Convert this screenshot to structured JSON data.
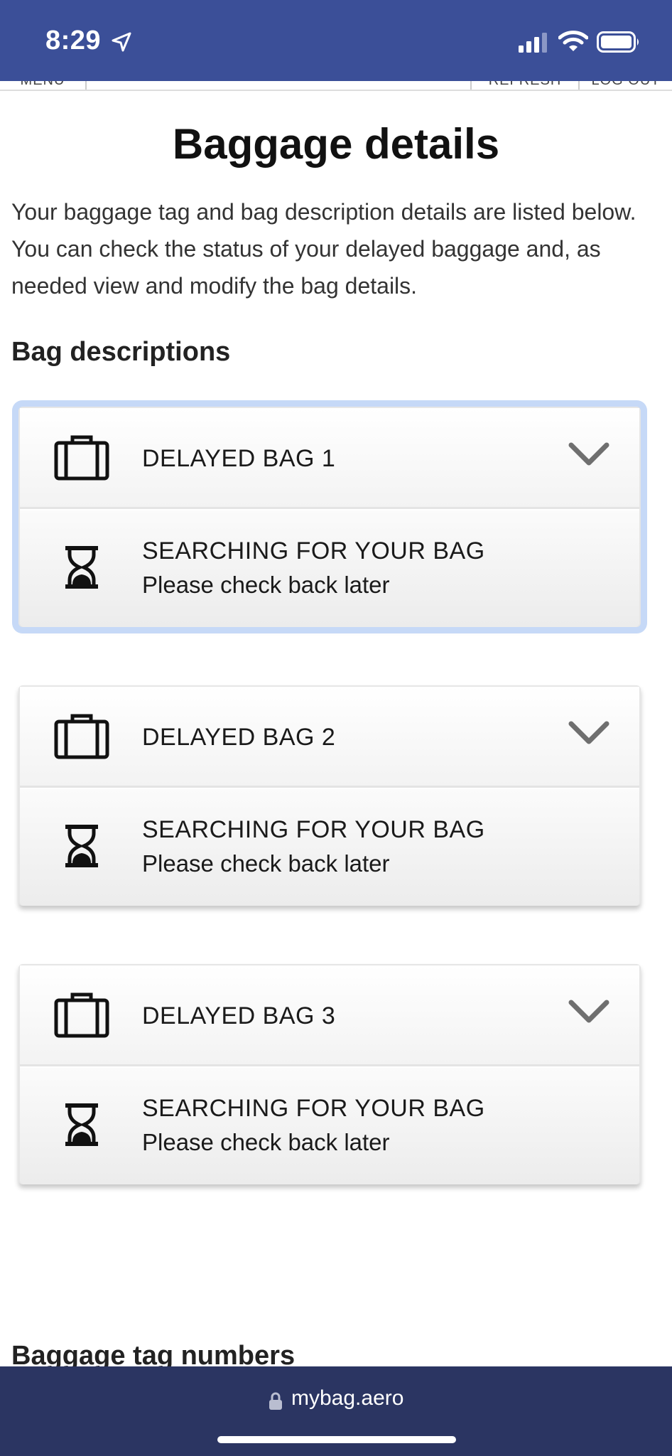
{
  "status_bar": {
    "time": "8:29",
    "icons": [
      "location-arrow-icon",
      "cellular-signal-icon",
      "wifi-icon",
      "battery-icon"
    ]
  },
  "topnav": {
    "menu_label": "MENU",
    "refresh_label": "REFRESH",
    "logout_label": "LOG OUT"
  },
  "page": {
    "title": "Baggage details",
    "intro": "Your baggage tag and bag description details are listed below. You can check the status of your delayed baggage and, as needed view and modify the bag details.",
    "section_title": "Bag descriptions",
    "next_section_title": "Baggage tag numbers"
  },
  "bags": [
    {
      "label": "DELAYED BAG 1",
      "status": "SEARCHING FOR YOUR BAG",
      "substatus": "Please check back later",
      "focused": true
    },
    {
      "label": "DELAYED BAG 2",
      "status": "SEARCHING FOR YOUR BAG",
      "substatus": "Please check back later",
      "focused": false
    },
    {
      "label": "DELAYED BAG 3",
      "status": "SEARCHING FOR YOUR BAG",
      "substatus": "Please check back later",
      "focused": false
    }
  ],
  "browser": {
    "url": "mybag.aero"
  },
  "colors": {
    "status_bar": "#3b4f98",
    "browser_bar": "#2b3562",
    "focus_ring": "#c6d9f7"
  }
}
